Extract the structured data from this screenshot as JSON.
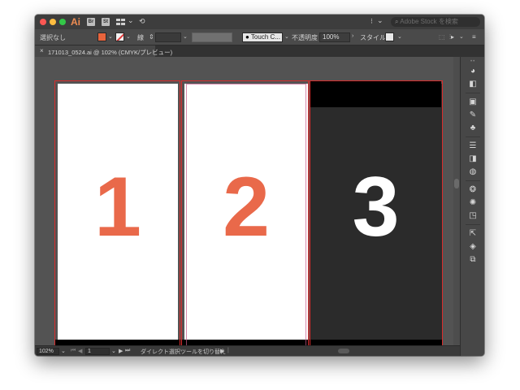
{
  "titlebar": {
    "app_logo": "Ai",
    "br_label": "Br",
    "st_label": "St",
    "layout_arrow": "⌄",
    "sync_glyph": "⟲",
    "workspace_glyph": "⁝",
    "workspace_arrow": "⌄",
    "stock_search_placeholder": "Adobe Stock を検索",
    "traffic_colors": {
      "close": "#fc5753",
      "minimize": "#fdbc40",
      "zoom": "#33c748"
    }
  },
  "controlbar": {
    "selection_label": "選択なし",
    "stroke_weight_label": "線",
    "stroke_weight_value": "",
    "brush_label": "Touch C...",
    "opacity_label": "不透明度 :",
    "opacity_value": "100%",
    "style_label": "スタイル :",
    "fill_color": "#e8643c"
  },
  "tab": {
    "close": "×",
    "label": "171013_0524.ai @ 102% (CMYK/プレビュー)"
  },
  "artboards": [
    {
      "number": "1",
      "background": "#ffffff",
      "number_color": "#e9694a"
    },
    {
      "number": "2",
      "background": "#ffffff",
      "number_color": "#e9694a"
    },
    {
      "number": "3",
      "background": "#2b2b2b",
      "number_color": "#ffffff"
    }
  ],
  "statusbar": {
    "zoom": "102%",
    "artboard_index": "1",
    "status_text": "ダイレクト選択ツールを切り替え"
  },
  "colors": {
    "accent_orange": "#e9694a",
    "bleed_red": "#d92c2c",
    "canvas_gray": "#535353"
  }
}
